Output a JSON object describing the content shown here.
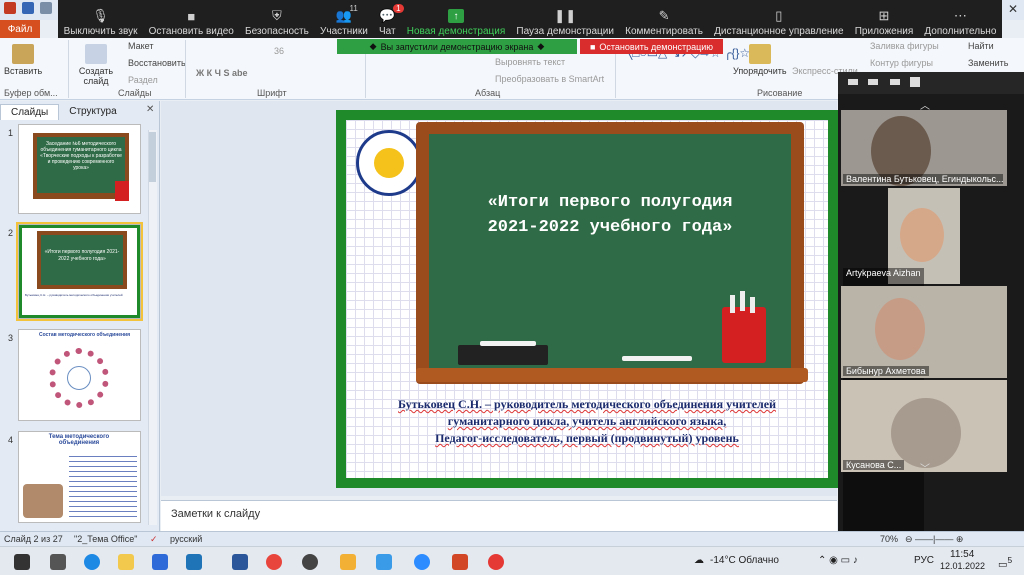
{
  "zoom": {
    "toolbar": [
      {
        "label": "Выключить звук",
        "icon": "mic-icon"
      },
      {
        "label": "Остановить видео",
        "icon": "video-icon"
      },
      {
        "label": "Безопасность",
        "icon": "shield-icon"
      },
      {
        "label": "Участники",
        "icon": "participants-icon",
        "count": "11"
      },
      {
        "label": "Чат",
        "icon": "chat-icon",
        "badge": "1"
      },
      {
        "label": "Новая демонстрация",
        "icon": "share-icon",
        "active": true
      },
      {
        "label": "Пауза демонстрации",
        "icon": "pause-icon"
      },
      {
        "label": "Комментировать",
        "icon": "pen-icon"
      },
      {
        "label": "Дистанционное управление",
        "icon": "mouse-icon"
      },
      {
        "label": "Приложения",
        "icon": "apps-icon"
      },
      {
        "label": "Дополнительно",
        "icon": "more-icon"
      }
    ],
    "share_banner": "Вы запустили демонстрацию экрана",
    "stop_banner": "Остановить демонстрацию",
    "participants": [
      {
        "name": "Валентина Бутьковец, Егиндыкольс..."
      },
      {
        "name": "Artykpaeva Aizhan"
      },
      {
        "name": "Бибынур Ахметова"
      },
      {
        "name": "Кусанова С..."
      }
    ]
  },
  "ppt": {
    "file_tab": "Файл",
    "ribbon": {
      "paste": "Вставить",
      "create_slide": "Создать слайд",
      "layout": "Макет",
      "reset": "Восстановить",
      "section": "Раздел",
      "font_size": "36",
      "align_text": "Выровнять текст",
      "smartart": "Преобразовать в SmartArt",
      "arrange": "Упорядочить",
      "quick_styles": "Экспресс-стили",
      "shape_fill": "Заливка фигуры",
      "shape_outline": "Контур фигуры",
      "find": "Найти",
      "replace": "Заменить",
      "groups": {
        "clipboard": "Буфер обм...",
        "slides": "Слайды",
        "font": "Шрифт",
        "paragraph": "Абзац",
        "drawing": "Рисование"
      }
    },
    "panel_tabs": {
      "slides": "Слайды",
      "outline": "Структура"
    },
    "thumb_numbers": [
      "1",
      "2",
      "3",
      "4"
    ],
    "thumbs": {
      "t1_text": "Заседание №6 методического объединения гуманитарного цикла «Творческие подходы к разработке и проведению современного урока»",
      "t2_text": "«Итоги первого полугодия 2021-2022 учебного года»",
      "t3_title": "Состав методического объединения",
      "t4_title": "Тема методического объединения"
    },
    "slide": {
      "board_title_line1": "«Итоги первого полугодия",
      "board_title_line2": "2021-2022 учебного года»",
      "body_line1": "Бутьковец С.Н. – руководитель методического объединения учителей",
      "body_line2": "гуманитарного цикла, учитель английского языка,",
      "body_line3": "Педагог-исследователь, первый (продвинутый) уровень"
    },
    "notes_placeholder": "Заметки к слайду",
    "status": {
      "slide_info": "Слайд 2 из 27",
      "theme": "\"2_Тема Office\"",
      "lang": "русский",
      "zoom": "70%"
    }
  },
  "taskbar": {
    "weather": "-14°C  Облачно",
    "lang": "РУС",
    "time": "11:54",
    "date": "12.01.2022",
    "notif": "5"
  }
}
